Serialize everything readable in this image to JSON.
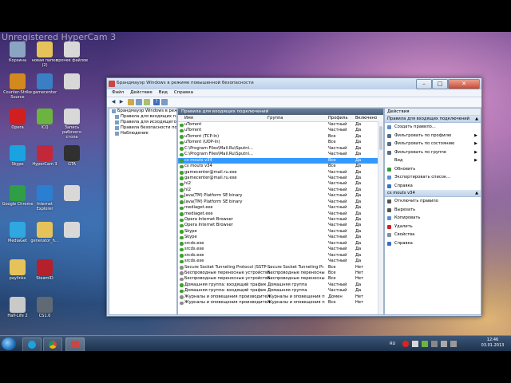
{
  "watermark": "Unregistered HyperCam 3",
  "desktop_icons": [
    {
      "label": "Корзина",
      "color": "#8aa4c2"
    },
    {
      "label": "новая папка (2)",
      "color": "#e6c35a"
    },
    {
      "label": "прочее файлов",
      "color": "#d8d8d8"
    },
    {
      "label": "Counter-Strike Source",
      "color": "#d28a1e"
    },
    {
      "label": "gamecenter",
      "color": "#3a7fc4"
    },
    {
      "label": "",
      "color": "#d8d8d8"
    },
    {
      "label": "Opera",
      "color": "#d11f1f"
    },
    {
      "label": "ICQ",
      "color": "#6cb33f"
    },
    {
      "label": "Запись рабочего стола",
      "color": "#d8d8d8"
    },
    {
      "label": "Skype",
      "color": "#1aa3e0"
    },
    {
      "label": "HyperCam 3",
      "color": "#c2283a"
    },
    {
      "label": "GTA",
      "color": "#303030"
    },
    {
      "label": "Google Chrome",
      "color": "#2f9e47"
    },
    {
      "label": "Internet Explorer",
      "color": "#2a7fd2"
    },
    {
      "label": "",
      "color": "#d8d8d8"
    },
    {
      "label": "MediaGet",
      "color": "#2fa7e0"
    },
    {
      "label": "generator_h...",
      "color": "#e6c35a"
    },
    {
      "label": "",
      "color": "#d8d8d8"
    },
    {
      "label": "paylinks",
      "color": "#e6c35a"
    },
    {
      "label": "SteamID",
      "color": "#b5202a"
    },
    {
      "label": "Half-Life 2",
      "color": "#c9c9c9"
    },
    {
      "label": "CS1.6",
      "color": "#5f6a75"
    }
  ],
  "window": {
    "title": "Брандмауэр Windows в режиме повышенной безопасности",
    "menu": [
      "Файл",
      "Действие",
      "Вид",
      "Справка"
    ],
    "min_label": "–",
    "max_label": "□",
    "close_label": "✕"
  },
  "tree": [
    {
      "label": "Брандмауэр Windows в режим...",
      "sub": false
    },
    {
      "label": "Правила для входящих п...",
      "sub": true
    },
    {
      "label": "Правила для исходящего п...",
      "sub": true
    },
    {
      "label": "Правила безопасности по...",
      "sub": true
    },
    {
      "label": "Наблюдение",
      "sub": true
    }
  ],
  "center": {
    "header": "Правила для входящих подключений",
    "columns": {
      "name": "Имя",
      "group": "Группа",
      "profile": "Профиль",
      "enabled": "Включено"
    },
    "rows": [
      {
        "name": "uTorrent",
        "group": "",
        "profile": "Частный",
        "enabled": "Да",
        "on": true,
        "selected": false
      },
      {
        "name": "uTorrent",
        "group": "",
        "profile": "Частный",
        "enabled": "Да",
        "on": true,
        "selected": false
      },
      {
        "name": "uTorrent (TCP-In)",
        "group": "",
        "profile": "Все",
        "enabled": "Да",
        "on": true,
        "selected": false
      },
      {
        "name": "uTorrent (UDP-In)",
        "group": "",
        "profile": "Все",
        "enabled": "Да",
        "on": true,
        "selected": false
      },
      {
        "name": "C:\\Program Files\\Mail.Ru\\Sputni...",
        "group": "",
        "profile": "Частный",
        "enabled": "Да",
        "on": true,
        "selected": false
      },
      {
        "name": "C:\\Program Files\\Mail.Ru\\Sputni...",
        "group": "",
        "profile": "Частный",
        "enabled": "Да",
        "on": true,
        "selected": false
      },
      {
        "name": "cs mouts v34",
        "group": "",
        "profile": "Все",
        "enabled": "Да",
        "on": true,
        "selected": true
      },
      {
        "name": "cs mouts v34",
        "group": "",
        "profile": "Все",
        "enabled": "Да",
        "on": true,
        "selected": false
      },
      {
        "name": "gamecenter@mail.ru.exe",
        "group": "",
        "profile": "Частный",
        "enabled": "Да",
        "on": true,
        "selected": false
      },
      {
        "name": "gamecenter@mail.ru.exe",
        "group": "",
        "profile": "Частный",
        "enabled": "Да",
        "on": true,
        "selected": false
      },
      {
        "name": "hl2",
        "group": "",
        "profile": "Частный",
        "enabled": "Да",
        "on": true,
        "selected": false
      },
      {
        "name": "hl2",
        "group": "",
        "profile": "Частный",
        "enabled": "Да",
        "on": true,
        "selected": false
      },
      {
        "name": "Java(TM) Platform SE binary",
        "group": "",
        "profile": "Частный",
        "enabled": "Да",
        "on": true,
        "selected": false
      },
      {
        "name": "Java(TM) Platform SE binary",
        "group": "",
        "profile": "Частный",
        "enabled": "Да",
        "on": true,
        "selected": false
      },
      {
        "name": "mediaget.exe",
        "group": "",
        "profile": "Частный",
        "enabled": "Да",
        "on": true,
        "selected": false
      },
      {
        "name": "mediaget.exe",
        "group": "",
        "profile": "Частный",
        "enabled": "Да",
        "on": true,
        "selected": false
      },
      {
        "name": "Opera Internet Browser",
        "group": "",
        "profile": "Частный",
        "enabled": "Да",
        "on": true,
        "selected": false
      },
      {
        "name": "Opera Internet Browser",
        "group": "",
        "profile": "Частный",
        "enabled": "Да",
        "on": true,
        "selected": false
      },
      {
        "name": "Skype",
        "group": "",
        "profile": "Частный",
        "enabled": "Да",
        "on": true,
        "selected": false
      },
      {
        "name": "Skype",
        "group": "",
        "profile": "Частный",
        "enabled": "Да",
        "on": true,
        "selected": false
      },
      {
        "name": "srcds.exe",
        "group": "",
        "profile": "Частный",
        "enabled": "Да",
        "on": true,
        "selected": false
      },
      {
        "name": "srcds.exe",
        "group": "",
        "profile": "Частный",
        "enabled": "Да",
        "on": true,
        "selected": false
      },
      {
        "name": "srcds.exe",
        "group": "",
        "profile": "Частный",
        "enabled": "Да",
        "on": true,
        "selected": false
      },
      {
        "name": "srcds.exe",
        "group": "",
        "profile": "Частный",
        "enabled": "Да",
        "on": true,
        "selected": false
      },
      {
        "name": "Secure Socket Tunneling Protocol (SSTP-...",
        "group": "Secure Socket Tunneling Pr...",
        "profile": "Все",
        "enabled": "Нет",
        "on": false,
        "selected": false
      },
      {
        "name": "Беспроводные переносные устройства...",
        "group": "Беспроводные переносные ...",
        "profile": "Все",
        "enabled": "Нет",
        "on": false,
        "selected": false
      },
      {
        "name": "Беспроводные переносные устройства...",
        "group": "Беспроводные переносные ...",
        "profile": "Все",
        "enabled": "Нет",
        "on": false,
        "selected": false
      },
      {
        "name": "Домашняя группа: входящий трафик",
        "group": "Домашняя группа",
        "profile": "Частный",
        "enabled": "Да",
        "on": true,
        "selected": false
      },
      {
        "name": "Домашняя группа: входящий трафик",
        "group": "Домашняя группа",
        "profile": "Частный",
        "enabled": "Да",
        "on": true,
        "selected": false
      },
      {
        "name": "Журналы и оповещения производител...",
        "group": "Журналы и оповещения про...",
        "profile": "Домен",
        "enabled": "Нет",
        "on": false,
        "selected": false
      },
      {
        "name": "Журналы и оповещения производител...",
        "group": "Журналы и оповещения про...",
        "profile": "Все",
        "enabled": "Нет",
        "on": false,
        "selected": false
      }
    ]
  },
  "actions": {
    "header": "Действия",
    "section1": "Правила для входящих подключений",
    "items1": [
      {
        "label": "Создать правило...",
        "icon_color": "#5a8fd0",
        "submenu": false
      },
      {
        "label": "Фильтровать по профилю",
        "icon_color": "#5a6b80",
        "submenu": true
      },
      {
        "label": "Фильтровать по состоянию",
        "icon_color": "#5a6b80",
        "submenu": true
      },
      {
        "label": "Фильтровать по группе",
        "icon_color": "#5a6b80",
        "submenu": true
      },
      {
        "label": "Вид",
        "icon_color": "#ffffff",
        "submenu": true
      },
      {
        "label": "Обновить",
        "icon_color": "#3a9a3a",
        "submenu": false
      },
      {
        "label": "Экспортировать список...",
        "icon_color": "#5a8fd0",
        "submenu": false
      },
      {
        "label": "Справка",
        "icon_color": "#3a6fc0",
        "submenu": false
      }
    ],
    "section2": "cs mouts v34",
    "items2": [
      {
        "label": "Отключить правило",
        "icon_color": "#555555"
      },
      {
        "label": "Вырезать",
        "icon_color": "#555555"
      },
      {
        "label": "Копировать",
        "icon_color": "#5a8fd0"
      },
      {
        "label": "Удалить",
        "icon_color": "#d02020"
      },
      {
        "label": "Свойства",
        "icon_color": "#8090a0"
      },
      {
        "label": "Справка",
        "icon_color": "#3a6fc0"
      }
    ]
  },
  "taskbar": {
    "lang": "RU",
    "time": "12:46",
    "date": "03.01.2013"
  }
}
